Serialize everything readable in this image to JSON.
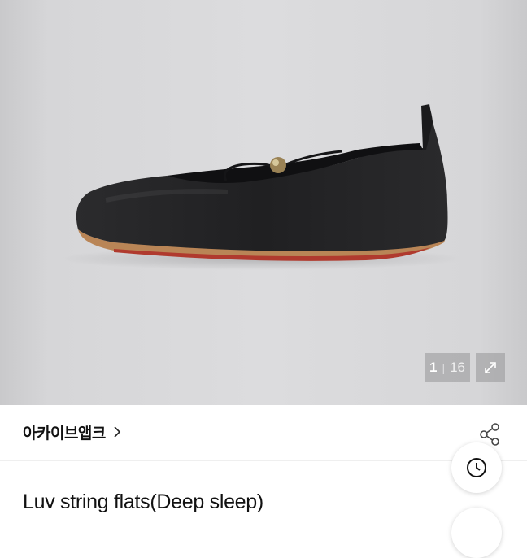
{
  "gallery": {
    "current_index": "1",
    "separator": "|",
    "total": "16",
    "expand_icon": "expand-arrow-icon"
  },
  "seller": {
    "name": "아카이브앱크",
    "chevron_icon": "chevron-right-icon",
    "share_icon": "share-icon"
  },
  "floating": {
    "recent_icon": "clock-icon"
  },
  "product": {
    "title": "Luv string flats(Deep sleep)"
  }
}
